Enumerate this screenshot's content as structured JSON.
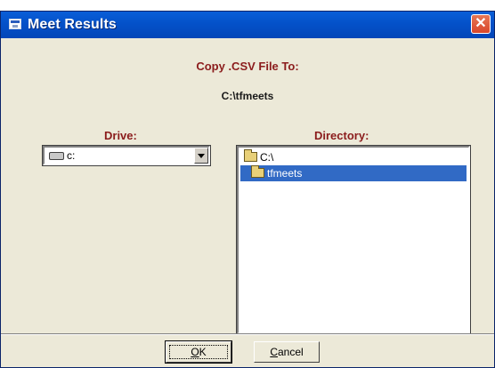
{
  "window": {
    "title": "Meet Results",
    "title_icon": "window-icon",
    "close_label": "✕"
  },
  "dialog": {
    "copy_label": "Copy .CSV File To:",
    "destination_path": "C:\\tfmeets",
    "drive_label": "Drive:",
    "directory_label": "Directory:"
  },
  "drive_select": {
    "icon": "drive-icon",
    "value": "c:"
  },
  "directory_list": {
    "items": [
      {
        "label": "C:\\",
        "icon": "open-folder-icon",
        "selected": false
      },
      {
        "label": "tfmeets",
        "icon": "open-folder-icon",
        "selected": true
      }
    ]
  },
  "buttons": {
    "ok": {
      "mnemonic": "O",
      "rest": "K"
    },
    "cancel": {
      "mnemonic": "C",
      "rest": "ancel"
    }
  },
  "colors": {
    "titlebar": "#0451c9",
    "label_red": "#8b1c1c",
    "selection": "#316ac5",
    "dialog_bg": "#ece9d8"
  }
}
